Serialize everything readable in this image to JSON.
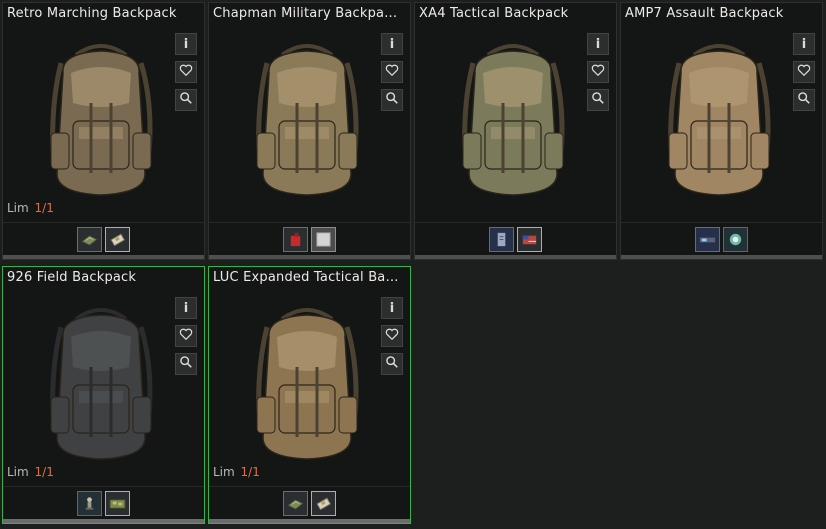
{
  "cards": [
    {
      "title": "Retro Marching Backpack",
      "lim_label": "Lim",
      "lim_value": "1/1",
      "color": "#7a6a52",
      "slots": [
        "mat-item",
        "chip-item"
      ]
    },
    {
      "title": "Chapman Military Backpa...",
      "color": "#8b7a58",
      "slots": [
        "fuel-can-item",
        "plate-item"
      ]
    },
    {
      "title": "XA4 Tactical Backpack",
      "color": "#7b7b5c",
      "slots": [
        "document-item",
        "flag-item"
      ]
    },
    {
      "title": "AMP7 Assault Backpack",
      "color": "#a08663",
      "slots": [
        "electronic-item",
        "badge-item"
      ]
    },
    {
      "title": "926 Field Backpack",
      "lim_label": "Lim",
      "lim_value": "1/1",
      "color": "#3f4142",
      "selected": true,
      "slots": [
        "figurine-item",
        "circuit-board-item"
      ]
    },
    {
      "title": "LUC Expanded Tactical Bac...",
      "lim_label": "Lim",
      "lim_value": "1/1",
      "color": "#8e7551",
      "selected": true,
      "slots": [
        "mat-item",
        "chip-item"
      ]
    }
  ],
  "buttons": {
    "info": "i",
    "favorite_icon": "heart-icon",
    "inspect_icon": "magnifier-icon"
  },
  "colors": {
    "background": "#1d1f1e",
    "card": "#141615",
    "selected_border": "#3bb04a",
    "limit_value": "#e0703a"
  }
}
